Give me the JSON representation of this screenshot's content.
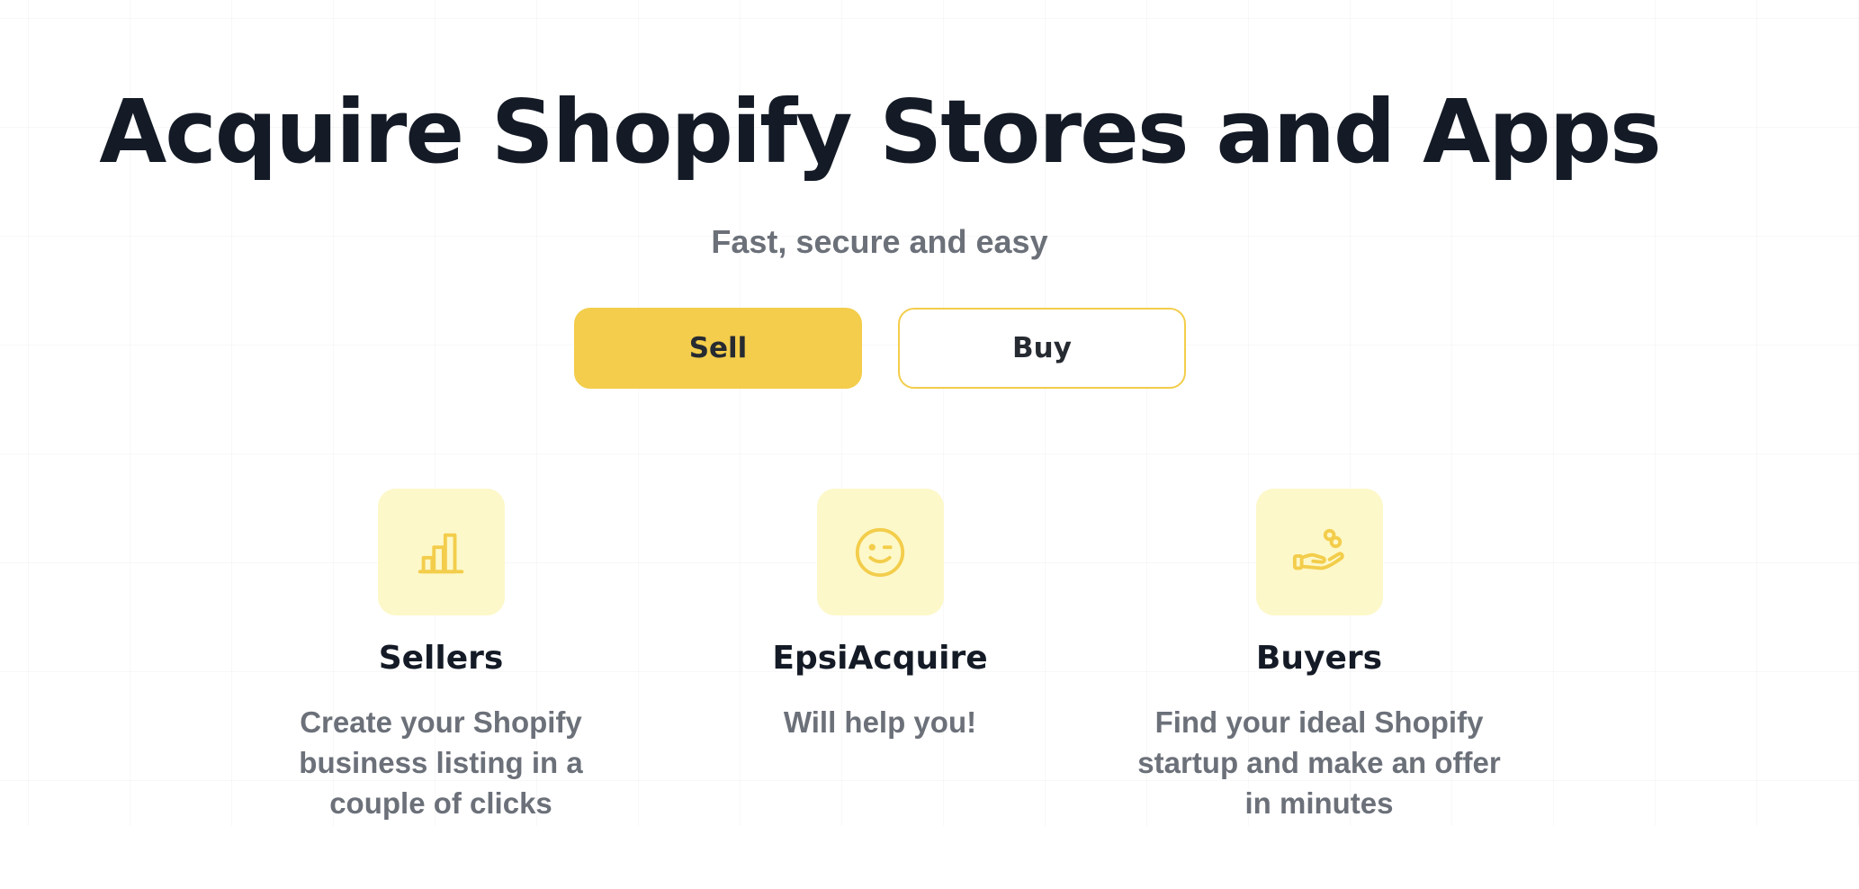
{
  "hero": {
    "title": "Acquire Shopify Stores and Apps",
    "subtitle": "Fast, secure and easy"
  },
  "actions": {
    "sell_label": "Sell",
    "buy_label": "Buy"
  },
  "features": [
    {
      "icon": "bar-chart-icon",
      "title": "Sellers",
      "description": "Create your Shopify business listing in a couple of clicks"
    },
    {
      "icon": "wink-face-icon",
      "title": "EpsiAcquire",
      "description": "Will help you!"
    },
    {
      "icon": "hand-coins-icon",
      "title": "Buyers",
      "description": "Find your ideal Shopify startup and make an offer in minutes"
    }
  ],
  "colors": {
    "accent": "#f3cd4b",
    "icon_bg": "#fdf8c9",
    "heading": "#141b26",
    "muted_text": "#6b7079"
  }
}
